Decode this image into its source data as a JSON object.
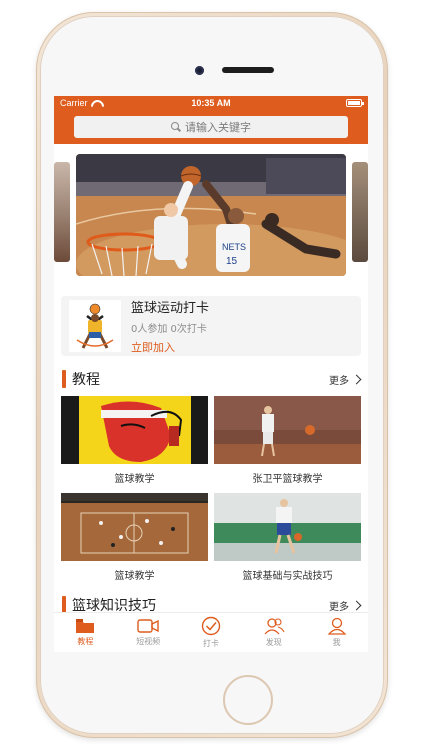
{
  "status_bar": {
    "carrier": "Carrier",
    "time": "10:35 AM"
  },
  "search": {
    "placeholder": "请输入关键字"
  },
  "checkin": {
    "title": "篮球运动打卡",
    "stats": "0人参加 0次打卡",
    "join_label": "立即加入"
  },
  "sections": {
    "tutorials": {
      "title": "教程",
      "more_label": "更多",
      "items": [
        {
          "label": "篮球教学"
        },
        {
          "label": "张卫平篮球教学"
        },
        {
          "label": "篮球教学"
        },
        {
          "label": "篮球基础与实战技巧"
        }
      ]
    },
    "skills": {
      "title": "篮球知识技巧",
      "more_label": "更多"
    }
  },
  "tabbar": {
    "items": [
      {
        "label": "教程",
        "icon": "folder-icon",
        "active": true
      },
      {
        "label": "短视频",
        "icon": "video-icon",
        "active": false
      },
      {
        "label": "打卡",
        "icon": "check-circle-icon",
        "active": false
      },
      {
        "label": "发现",
        "icon": "people-icon",
        "active": false
      },
      {
        "label": "我",
        "icon": "person-icon",
        "active": false
      }
    ]
  },
  "colors": {
    "accent": "#de5c1d",
    "background": "#ffffff",
    "card": "#f4f4f4"
  }
}
